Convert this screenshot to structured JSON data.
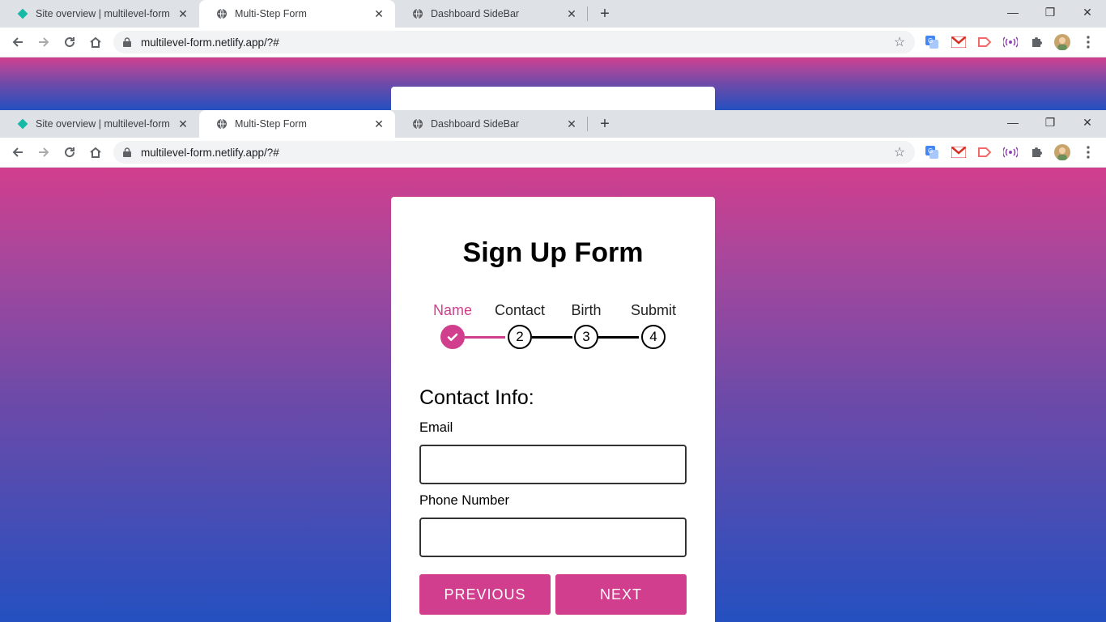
{
  "browser": {
    "tabs": [
      {
        "title": "Site overview | multilevel-form",
        "icon": "netlify-diamond-icon",
        "active": false
      },
      {
        "title": "Multi-Step Form",
        "icon": "globe-icon",
        "active": true
      },
      {
        "title": "Dashboard SideBar",
        "icon": "globe-icon",
        "active": false
      }
    ],
    "close_glyph": "✕",
    "new_tab_glyph": "+",
    "url": "multilevel-form.netlify.app/?#",
    "window_controls": {
      "minimize": "—",
      "restore": "❐",
      "close": "✕"
    }
  },
  "form": {
    "title": "Sign Up Form",
    "steps": [
      {
        "label": "Name",
        "number": "",
        "done": true
      },
      {
        "label": "Contact",
        "number": "2",
        "done": false
      },
      {
        "label": "Birth",
        "number": "3",
        "done": false
      },
      {
        "label": "Submit",
        "number": "4",
        "done": false
      }
    ],
    "section_title": "Contact Info:",
    "email_label": "Email",
    "email_value": "",
    "phone_label": "Phone Number",
    "phone_value": "",
    "previous_label": "PREVIOUS",
    "next_label": "NEXT"
  },
  "colors": {
    "accent": "#d13e8d",
    "gradient_top": "#d13e8d",
    "gradient_bottom": "#2450c0"
  }
}
